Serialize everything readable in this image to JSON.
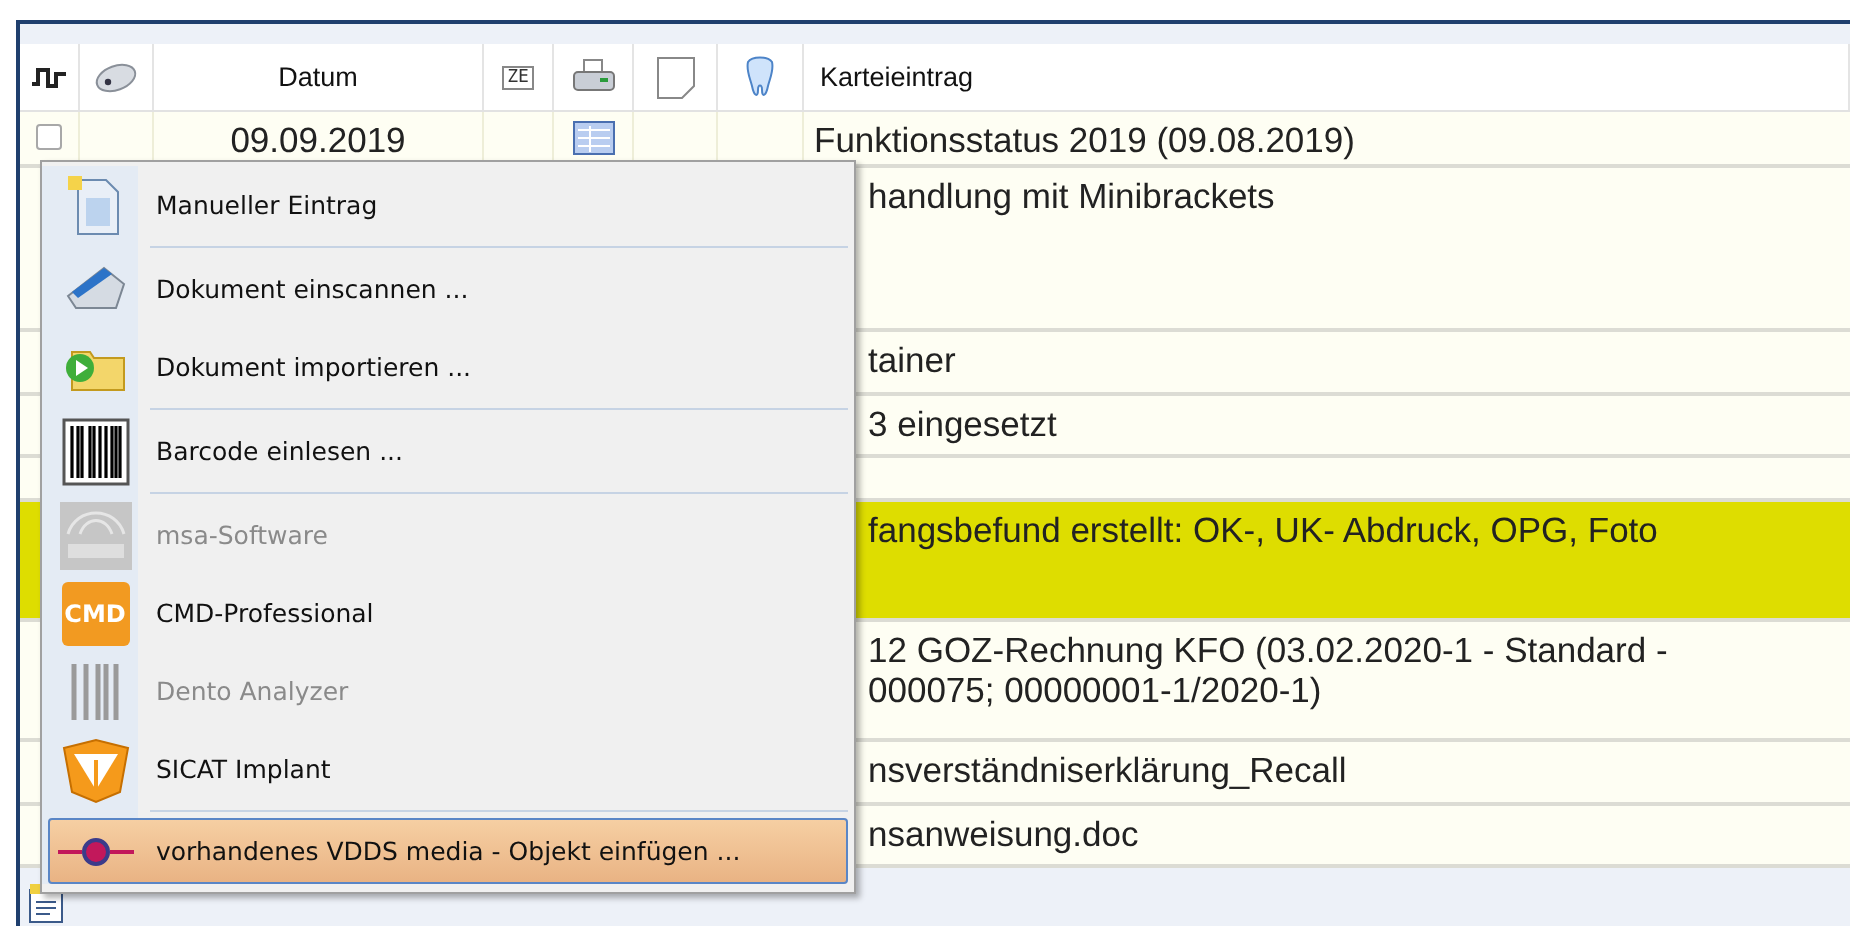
{
  "table": {
    "columns": [
      {
        "kind": "link"
      },
      {
        "kind": "mouse"
      },
      {
        "kind": "text",
        "label": "Datum"
      },
      {
        "kind": "badge",
        "label": "ZE"
      },
      {
        "kind": "printer"
      },
      {
        "kind": "note"
      },
      {
        "kind": "tooth"
      },
      {
        "kind": "text",
        "label": "Karteieintrag"
      }
    ],
    "rows": [
      {
        "checked": false,
        "date": "09.09.2019",
        "doc": true,
        "entry": "Funktionsstatus 2019 (09.08.2019)",
        "highlighted": false
      },
      {
        "entry": "handlung mit Minibrackets",
        "highlighted": false
      },
      {
        "entry": "tainer",
        "highlighted": false
      },
      {
        "entry": "3 eingesetzt",
        "highlighted": false
      },
      {
        "highlighted": false
      },
      {
        "entry": "fangsbefund erstellt: OK-, UK- Abdruck, OPG, Foto",
        "highlighted": true
      },
      {
        "entry": "12 GOZ-Rechnung KFO (03.02.2020-1 - Standard -\n000075; 00000001-1/2020-1)",
        "highlighted": false
      },
      {
        "entry": "nsverständniserklärung_Recall",
        "highlighted": false
      },
      {
        "entry": "nsanweisung.doc",
        "highlighted": false
      }
    ]
  },
  "context_menu": {
    "groups": [
      [
        {
          "label": "Manueller Eintrag",
          "disabled": false,
          "selected": false
        }
      ],
      [
        {
          "label": "Dokument einscannen ...",
          "disabled": false,
          "selected": false
        },
        {
          "label": "Dokument importieren ...",
          "disabled": false,
          "selected": false
        }
      ],
      [
        {
          "label": "Barcode einlesen ...",
          "disabled": false,
          "selected": false
        }
      ],
      [
        {
          "label": "msa-Software",
          "disabled": true,
          "selected": false
        },
        {
          "label": "CMD-Professional",
          "icon_label": "CMD",
          "disabled": false,
          "selected": false
        },
        {
          "label": "Dento Analyzer",
          "disabled": true,
          "selected": false
        },
        {
          "label": "SICAT Implant",
          "disabled": false,
          "selected": false
        }
      ],
      [
        {
          "label": "vorhandenes VDDS media - Objekt einfügen ...",
          "disabled": false,
          "selected": true
        }
      ]
    ]
  }
}
